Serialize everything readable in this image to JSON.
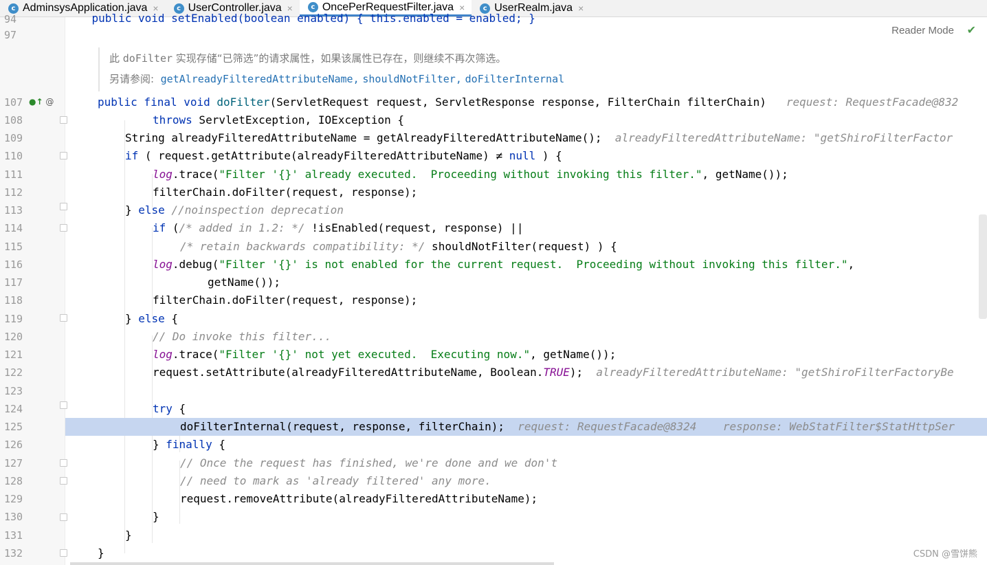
{
  "tabs": [
    {
      "icon": "c",
      "label": "AdminsysApplication.java",
      "active": false
    },
    {
      "icon": "c",
      "label": "UserController.java",
      "active": false
    },
    {
      "icon": "c",
      "label": "OncePerRequestFilter.java",
      "active": true
    },
    {
      "icon": "c",
      "label": "UserRealm.java",
      "active": false
    }
  ],
  "close_glyph": "×",
  "reader_mode": "Reader Mode",
  "watermark": "CSDN @雪饼熊",
  "doc": {
    "text_prefix": "此 ",
    "text_code": "doFilter",
    "text_suffix": " 实现存储“已筛选”的请求属性，如果该属性已存在，则继续不再次筛选。",
    "see_label": "另请参阅:",
    "see_links": [
      "getAlreadyFilteredAttributeName,",
      "shouldNotFilter,",
      "doFilterInternal"
    ]
  },
  "line_numbers": [
    "94",
    "97",
    "107",
    "108",
    "109",
    "110",
    "111",
    "112",
    "113",
    "114",
    "115",
    "116",
    "117",
    "118",
    "119",
    "120",
    "121",
    "122",
    "123",
    "124",
    "125",
    "126",
    "127",
    "128",
    "129",
    "130",
    "131",
    "132"
  ],
  "code": {
    "l94": "    public void setEnabled(boolean enabled) { this.enabled = enabled; }",
    "l107_a": "public final void ",
    "l107_b": "doFilter",
    "l107_c": "(ServletRequest request, ServletResponse response, FilterChain filterChain)",
    "l107_hint": "request: RequestFacade@832",
    "l108_kw": "throws",
    "l108_rest": " ServletException, IOException {",
    "l109": "String alreadyFilteredAttributeName = getAlreadyFilteredAttributeName();",
    "l109_hint": "alreadyFilteredAttributeName: \"getShiroFilterFactor",
    "l110_kw": "if",
    "l110_rest": " ( request.getAttribute(alreadyFilteredAttributeName) ≠ ",
    "l110_null": "null",
    "l110_end": " ) {",
    "l111_log": "log",
    "l111_a": ".trace(",
    "l111_str": "\"Filter '{}' already executed.  Proceeding without invoking this filter.\"",
    "l111_b": ", getName());",
    "l112": "filterChain.doFilter(request, response);",
    "l113_a": "} ",
    "l113_kw": "else",
    "l113_cm": " //noinspection deprecation",
    "l114_kw": "if",
    "l114_a": " (",
    "l114_cm": "/* added in 1.2: */",
    "l114_b": " !isEnabled(request, response) ||",
    "l115_cm": "/* retain backwards compatibility: */",
    "l115_b": " shouldNotFilter(request) ) {",
    "l116_log": "log",
    "l116_a": ".debug(",
    "l116_str": "\"Filter '{}' is not enabled for the current request.  Proceeding without invoking this filter.\"",
    "l116_b": ",",
    "l117": "getName());",
    "l118": "filterChain.doFilter(request, response);",
    "l119_a": "} ",
    "l119_kw": "else",
    "l119_b": " {",
    "l120_cm": "// Do invoke this filter...",
    "l121_log": "log",
    "l121_a": ".trace(",
    "l121_str": "\"Filter '{}' not yet executed.  Executing now.\"",
    "l121_b": ", getName());",
    "l122_a": "request.setAttribute(alreadyFilteredAttributeName, Boolean.",
    "l122_fld": "TRUE",
    "l122_b": ");",
    "l122_hint": "alreadyFilteredAttributeName: \"getShiroFilterFactoryBe",
    "l124_kw": "try",
    "l124_b": " {",
    "l125": "doFilterInternal(request, response, filterChain);",
    "l125_hint1": "request: RequestFacade@8324",
    "l125_hint2": "response: WebStatFilter$StatHttpSer",
    "l126_a": "} ",
    "l126_kw": "finally",
    "l126_b": " {",
    "l127_cm": "// Once the request has finished, we're done and we don't",
    "l128_cm": "// need to mark as 'already filtered' any more.",
    "l129": "request.removeAttribute(alreadyFilteredAttributeName);",
    "l130": "}",
    "l131": "}",
    "l132": "}"
  }
}
